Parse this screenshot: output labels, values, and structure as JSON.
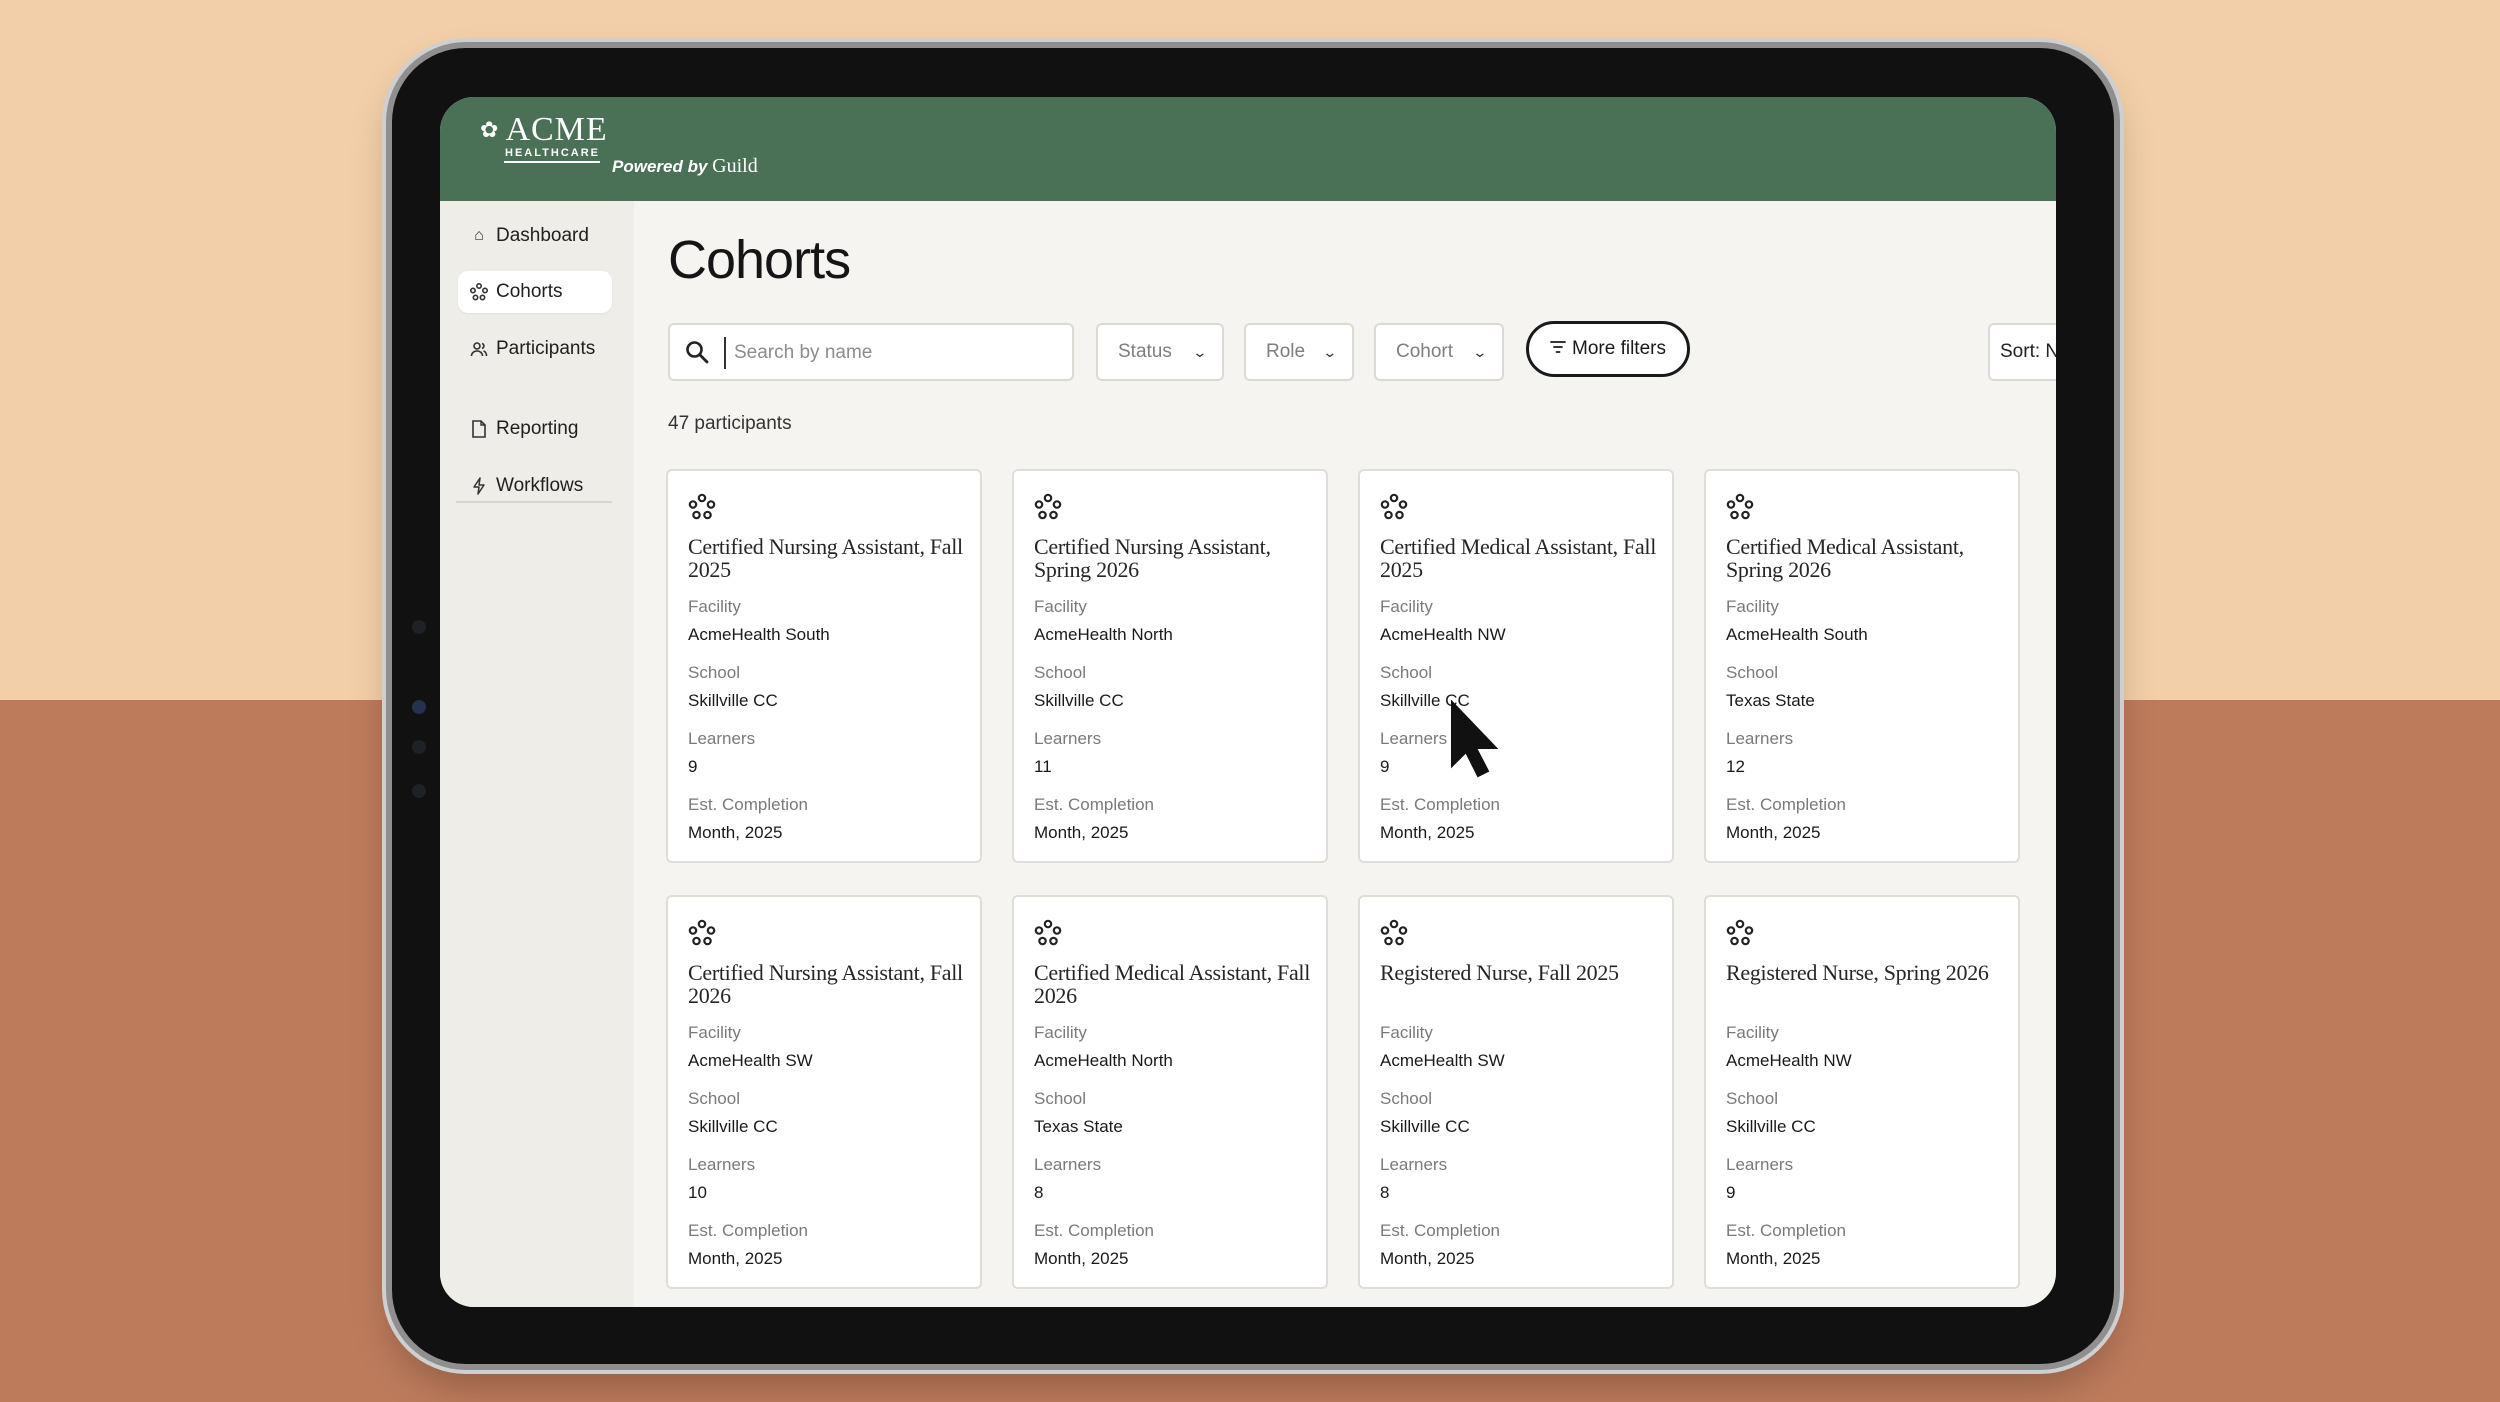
{
  "brand": {
    "logo_text": "ACME",
    "logo_sub": "HEALTHCARE",
    "powered_by": "Powered by ",
    "partner": "Guild"
  },
  "sidebar": {
    "items": [
      {
        "label": "Dashboard",
        "icon": "home-icon"
      },
      {
        "label": "Cohorts",
        "icon": "cohort-icon"
      },
      {
        "label": "Participants",
        "icon": "participants-icon"
      },
      {
        "label": "Reporting",
        "icon": "document-icon"
      },
      {
        "label": "Workflows",
        "icon": "bolt-icon"
      }
    ],
    "active": "Cohorts"
  },
  "page": {
    "title": "Cohorts",
    "search_placeholder": "Search by name",
    "filters": {
      "status": "Status",
      "role": "Role",
      "cohort": "Cohort",
      "more": "More filters"
    },
    "sort": "Sort: N",
    "count": "47 participants"
  },
  "field_labels": {
    "facility": "Facility",
    "school": "School",
    "learners": "Learners",
    "completion": "Est. Completion"
  },
  "cohorts": [
    {
      "title": "Certified Nursing Assistant, Fall 2025",
      "facility": "AcmeHealth South",
      "school": "Skillville CC",
      "learners": "9",
      "completion": "Month, 2025"
    },
    {
      "title": "Certified Nursing Assistant, Spring 2026",
      "facility": "AcmeHealth North",
      "school": "Skillville CC",
      "learners": "11",
      "completion": "Month, 2025"
    },
    {
      "title": "Certified Medical Assistant, Fall 2025",
      "facility": "AcmeHealth NW",
      "school": "Skillville CC",
      "learners": "9",
      "completion": "Month, 2025"
    },
    {
      "title": "Certified Medical Assistant, Spring 2026",
      "facility": "AcmeHealth South",
      "school": "Texas State",
      "learners": "12",
      "completion": "Month, 2025"
    },
    {
      "title": "Certified Nursing Assistant, Fall 2026",
      "facility": "AcmeHealth SW",
      "school": "Skillville CC",
      "learners": "10",
      "completion": "Month, 2025"
    },
    {
      "title": "Certified Medical Assistant, Fall 2026",
      "facility": "AcmeHealth North",
      "school": "Texas State",
      "learners": "8",
      "completion": "Month, 2025"
    },
    {
      "title": "Registered Nurse, Fall 2025",
      "facility": "AcmeHealth SW",
      "school": "Skillville CC",
      "learners": "8",
      "completion": "Month, 2025"
    },
    {
      "title": "Registered Nurse, Spring 2026",
      "facility": "AcmeHealth NW",
      "school": "Skillville CC",
      "learners": "9",
      "completion": "Month, 2025"
    }
  ],
  "colors": {
    "header": "#4a7055",
    "background_top": "#f2cfa8",
    "background_bottom": "#bd7b5c"
  }
}
